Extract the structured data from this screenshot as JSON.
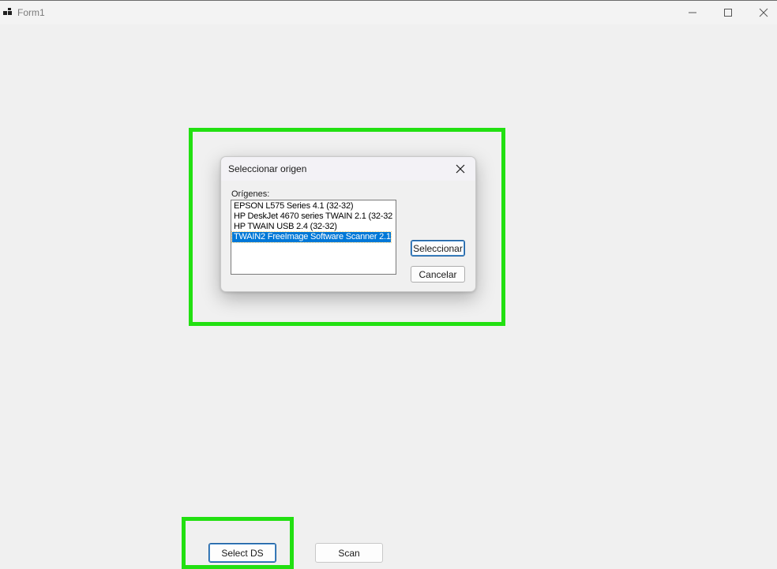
{
  "window": {
    "title": "Form1"
  },
  "caption_buttons": {
    "minimize_icon": "minimize-icon",
    "maximize_icon": "maximize-icon",
    "close_icon": "close-icon"
  },
  "dialog": {
    "title": "Seleccionar origen",
    "close_icon": "close-icon",
    "origins_label": "Orígenes:",
    "sources": [
      "EPSON L575 Series 4.1 (32-32)",
      "HP DeskJet 4670 series TWAIN 2.1 (32-32",
      "HP TWAIN USB 2.4 (32-32)",
      "TWAIN2 FreeImage Software Scanner 2.1"
    ],
    "selected_index": 3,
    "select_label": "Seleccionar",
    "cancel_label": "Cancelar"
  },
  "form": {
    "select_ds_label": "Select DS",
    "scan_label": "Scan"
  },
  "colors": {
    "highlight": "#22e011",
    "selection": "#0078d7",
    "background": "#f0f0f0"
  }
}
